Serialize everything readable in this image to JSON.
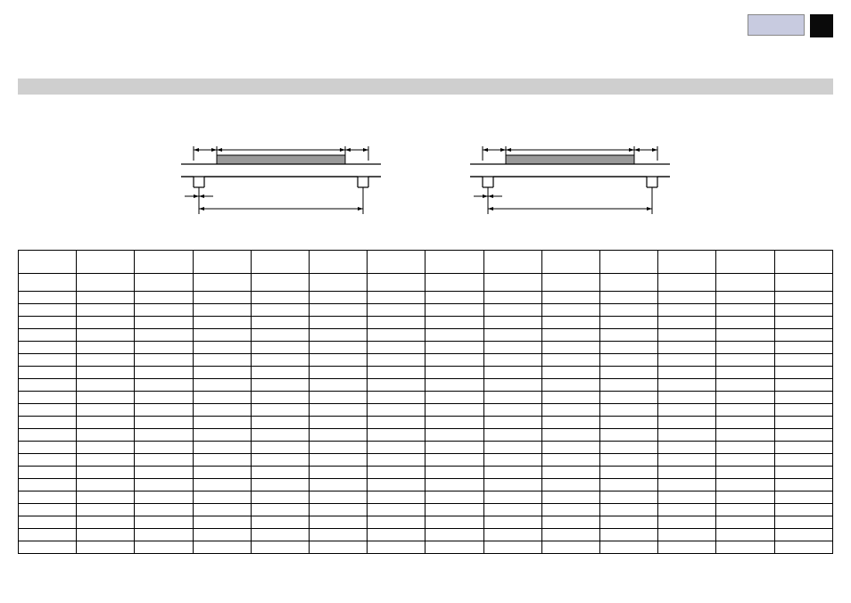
{
  "topRight": {
    "lightBox": "",
    "darkBox": ""
  },
  "band": "",
  "diagrams": {
    "left": "",
    "right": ""
  },
  "table": {
    "columns": 14,
    "rows": 23,
    "headers": [
      "",
      "",
      "",
      "",
      "",
      "",
      "",
      "",
      "",
      "",
      "",
      "",
      "",
      ""
    ],
    "data": []
  }
}
